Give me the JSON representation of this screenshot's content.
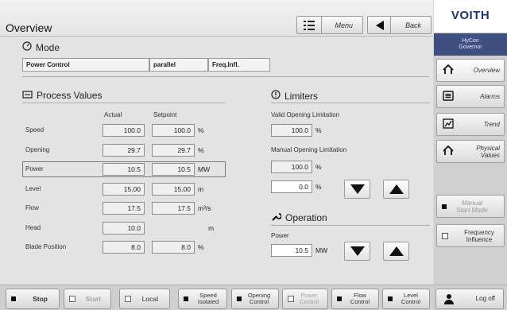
{
  "header": {
    "title": "Overview",
    "menu_label": "Menu",
    "back_label": "Back"
  },
  "brand": {
    "logo": "VOITH",
    "product_line1": "HyCon",
    "product_line2": "Governor"
  },
  "sidebar": {
    "items": [
      {
        "label": "Overview",
        "icon": "home-icon"
      },
      {
        "label": "Alarms",
        "icon": "list-icon"
      },
      {
        "label": "Trend",
        "icon": "trend-icon"
      },
      {
        "label": "Physical Values",
        "icon": "home-icon"
      },
      {
        "label": "Manual Start Mode",
        "icon": "square-icon"
      },
      {
        "label": "Frequency Influence",
        "icon": "checkbox-icon"
      }
    ]
  },
  "mode": {
    "title": "Mode",
    "cells": [
      "Power Control",
      "parallel",
      "Freq.Infl."
    ]
  },
  "process_values": {
    "title": "Process Values",
    "col_actual": "Actual",
    "col_setpoint": "Setpoint",
    "rows": [
      {
        "label": "Speed",
        "actual": "100.0",
        "setpoint": "100.0",
        "unit": "%"
      },
      {
        "label": "Opening",
        "actual": "29.7",
        "setpoint": "29.7",
        "unit": "%"
      },
      {
        "label": "Power",
        "actual": "10.5",
        "setpoint": "10.5",
        "unit": "MW"
      },
      {
        "label": "Level",
        "actual": "15.00",
        "setpoint": "15.00",
        "unit": "m"
      },
      {
        "label": "Flow",
        "actual": "17.5",
        "setpoint": "17.5",
        "unit": "m³/s"
      },
      {
        "label": "Head",
        "actual": "10.0",
        "setpoint": "",
        "unit": "m"
      },
      {
        "label": "Blade Position",
        "actual": "8.0",
        "setpoint": "8.0",
        "unit": "%"
      }
    ]
  },
  "limiters": {
    "title": "Limiters",
    "valid_label": "Valid Opening Limitation",
    "valid_value": "100.0",
    "valid_unit": "%",
    "manual_label": "Manual Opening Limitation",
    "manual_value": "100.0",
    "manual_unit": "%",
    "manual_input": "0.0",
    "manual_input_unit": "%"
  },
  "operation": {
    "title": "Operation",
    "power_label": "Power",
    "power_value": "10.5",
    "power_unit": "MW"
  },
  "bottom_bar": {
    "stop": "Stop",
    "start": "Start",
    "local": "Local",
    "speed_isolated": "Speed Isolated",
    "opening_control": "Opening Control",
    "power_control": "Power Control",
    "flow_control": "Flow Control",
    "level_control": "Level Control",
    "logoff": "Log off"
  }
}
